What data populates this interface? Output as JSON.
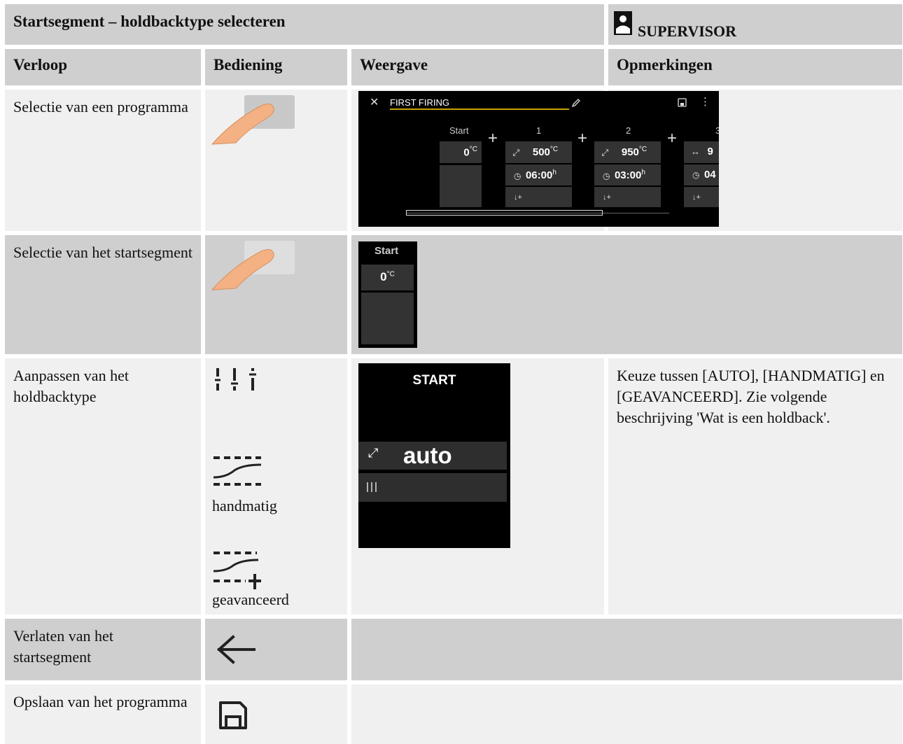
{
  "header": {
    "title": "Startsegment – holdbacktype selecteren",
    "role": "SUPERVISOR"
  },
  "columns": [
    "Verloop",
    "Bediening",
    "Weergave",
    "Opmerkingen"
  ],
  "rows": [
    {
      "step": "Selectie van een programma"
    },
    {
      "step": "Selectie van het startsegment"
    },
    {
      "step": "Aanpassen van het holdbacktype",
      "controls": [
        "handmatig",
        "geavanceerd"
      ],
      "remark": "Keuze tussen [AUTO], [HANDMATIG] en [GEAVANCEERD]. Zie volgende beschrijving 'Wat is een holdback'."
    },
    {
      "step": "Verlaten van het startsegment"
    },
    {
      "step": "Opslaan van het programma"
    }
  ],
  "program_screen": {
    "name": "FIRST FIRING",
    "start_label": "Start",
    "start_temp": "0",
    "temp_unit": "°C",
    "time_unit": "h",
    "segments": [
      {
        "number": "1",
        "temp": "500",
        "time": "06:00"
      },
      {
        "number": "2",
        "temp": "950",
        "time": "03:00"
      },
      {
        "number": "3",
        "temp": "9",
        "time": "04"
      }
    ]
  },
  "start_screen": {
    "label": "Start",
    "temp": "0",
    "unit": "°C"
  },
  "holdback_screen": {
    "title": "START",
    "mode": "auto"
  },
  "icons": [
    "touch-finger-icon",
    "close-icon",
    "edit-pencil-icon",
    "save-icon",
    "more-vert-icon",
    "ramp-icon",
    "dwell-icon",
    "clock-icon",
    "holdback-icon",
    "sliders-icon",
    "holdback-manual-icon",
    "holdback-advanced-icon",
    "back-arrow-icon"
  ],
  "colors": {
    "header_bg": "#cfcfcf",
    "cell_bg": "#f0f0f0",
    "screen_bg": "#000000",
    "segment_bg": "#333333",
    "accent": "#c8a200"
  }
}
